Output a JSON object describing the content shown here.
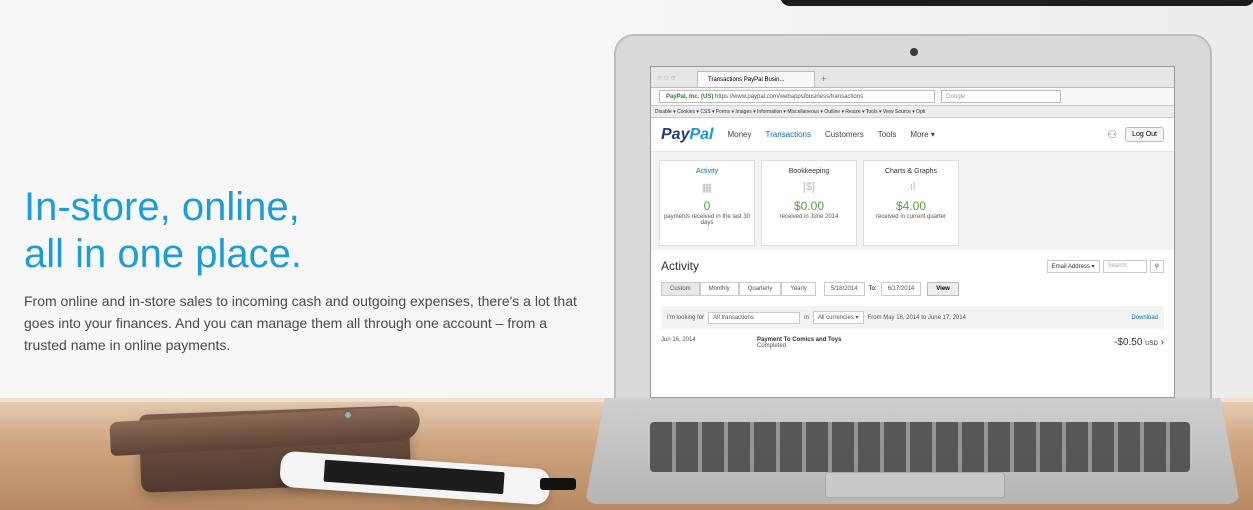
{
  "hero": {
    "headline_line1": "In-store, online,",
    "headline_line2": "all in one place.",
    "body": "From online and in-store sales to incoming cash and outgoing expenses, there's a lot that goes into your finances. And you can manage them all through one account – from a trusted name in online payments."
  },
  "browser": {
    "window_controls": "○○○",
    "tab_title": "Transactions PayPal Busin...",
    "new_tab": "+",
    "url_site": "PayPal, Inc. (US)",
    "url_text": "https://www.paypal.com/webapps/business/transactions",
    "search_engine": "Google",
    "webdev_toolbar": "Disable ▾  Cookies ▾  CSS ▾  Forms ▾  Images ▾  Information ▾  Miscellaneous ▾  Outline ▾  Resize ▾  Tools ▾  View Source ▾  Opti"
  },
  "paypal": {
    "logo_pay": "Pay",
    "logo_pal": "Pal",
    "nav": [
      "Money",
      "Transactions",
      "Customers",
      "Tools",
      "More ▾"
    ],
    "logout": "Log Out",
    "cards": [
      {
        "title": "Activity",
        "value": "0",
        "caption": "payments received in the last 30 days",
        "icon": "▦"
      },
      {
        "title": "Bookkeeping",
        "value": "$0.00",
        "caption": "received in June 2014",
        "icon": "[$]"
      },
      {
        "title": "Charts & Graphs",
        "value": "$4.00",
        "caption": "received in current quarter",
        "icon": ".ıl"
      }
    ],
    "activity": {
      "title": "Activity",
      "filter_select": "Email Address ▾",
      "search_placeholder": "Search",
      "segments": [
        "Custom",
        "Monthly",
        "Quarterly",
        "Yearly"
      ],
      "date_from": "5/18/2014",
      "to_label": "To:",
      "date_to": "6/17/2014",
      "view_button": "View",
      "looking_for_label": "I'm looking for",
      "type_select": "All transactions",
      "in_label": "in",
      "currency_select": "All currencies ▾",
      "range_text": "From  May 18, 2014  to  June 17, 2014",
      "download": "Download",
      "row": {
        "date": "Jun 16, 2014",
        "title": "Payment To Comics and Toys",
        "status": "Completed",
        "amount": "-$0.50",
        "currency": "USD"
      }
    }
  }
}
